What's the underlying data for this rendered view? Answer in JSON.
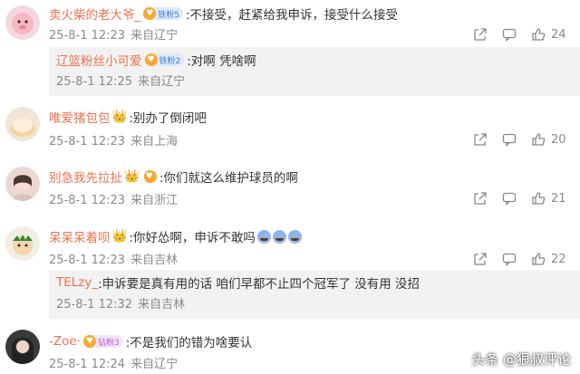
{
  "comments": [
    {
      "user": "卖火柴的老大爷_",
      "fan_badge": "铁粉5",
      "text": ":不接受，赶紧给我申诉，接受什么接受",
      "date": "25-8-1 12:23",
      "location": "来自辽宁",
      "likes": "24",
      "reply": {
        "user": "辽篮粉丝小可爱",
        "fan_badge": "铁粉2",
        "text": ":对啊 凭啥啊",
        "date": "25-8-1 12:25",
        "location": "来自辽宁"
      }
    },
    {
      "user": "唯爱猪包包",
      "text": ":别办了倒闭吧",
      "date": "25-8-1 12:23",
      "location": "来自上海",
      "likes": "20"
    },
    {
      "user": "别急我先拉扯",
      "text": ":你们就这么维护球员的啊",
      "date": "25-8-1 12:23",
      "location": "来自浙江",
      "likes": "21"
    },
    {
      "user": "呆呆呆着呗",
      "text": ":你好怂啊，申诉不敢吗",
      "date": "25-8-1 12:23",
      "location": "来自吉林",
      "likes": "22",
      "reply": {
        "user": "TELzy_",
        "text": ":申诉要是真有用的话 咱们早都不止四个冠军了 没有用 没招",
        "date": "25-8-1 12:32",
        "location": "来自吉林"
      }
    },
    {
      "user": "-Zoe·",
      "fan_badge": "钻粉3",
      "text": ":不是我们的错为啥要认",
      "date": "25-8-1 12:24",
      "location": "来自辽宁"
    }
  ],
  "watermark": "头条 @狠叔评论",
  "colors": {
    "username": "#eb7350",
    "meta": "#8a8a8a",
    "reply_bg": "#f2f2f2"
  },
  "icons": [
    "share-icon",
    "comment-icon",
    "like-icon",
    "crown-icon",
    "fan-badge-icon"
  ]
}
